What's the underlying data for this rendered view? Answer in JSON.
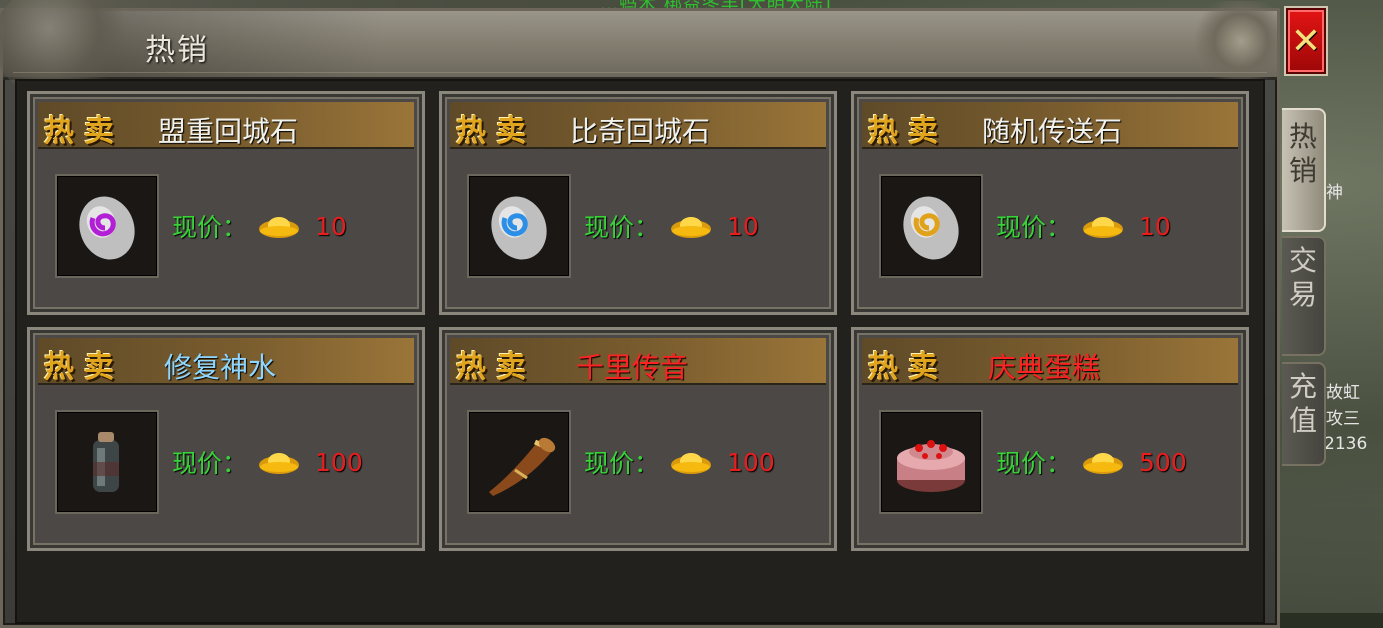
{
  "panel": {
    "title": "热销",
    "close_label": "✕"
  },
  "tabs": [
    {
      "line1": "热",
      "line2": "销",
      "active": true
    },
    {
      "line1": "交",
      "line2": "易",
      "active": false
    },
    {
      "line1": "充",
      "line2": "值",
      "active": false
    }
  ],
  "world": {
    "top_text": "…蚂木 梆益冬丰[大明大陆]",
    "side_text_1": "神",
    "side_text_2": "故虹",
    "side_text_3": "攻三",
    "side_text_4": "2136"
  },
  "badge_text": "热卖",
  "price_label": "现价：",
  "items": [
    {
      "name": "盟重回城石",
      "price": "10",
      "name_color": "white",
      "icon": "return-stone-purple-icon"
    },
    {
      "name": "比奇回城石",
      "price": "10",
      "name_color": "white",
      "icon": "return-stone-blue-icon"
    },
    {
      "name": "随机传送石",
      "price": "10",
      "name_color": "white",
      "icon": "return-stone-gold-icon"
    },
    {
      "name": "修复神水",
      "price": "100",
      "name_color": "blue",
      "icon": "repair-potion-icon"
    },
    {
      "name": "千里传音",
      "price": "100",
      "name_color": "red",
      "icon": "horn-icon"
    },
    {
      "name": "庆典蛋糕",
      "price": "500",
      "name_color": "red",
      "icon": "cake-icon"
    }
  ],
  "colors": {
    "price_label": "#37d437",
    "price_value": "#e61e1e",
    "badge": "#e1a41d",
    "name_blue": "#8fd6ff",
    "name_red": "#ff2222"
  }
}
